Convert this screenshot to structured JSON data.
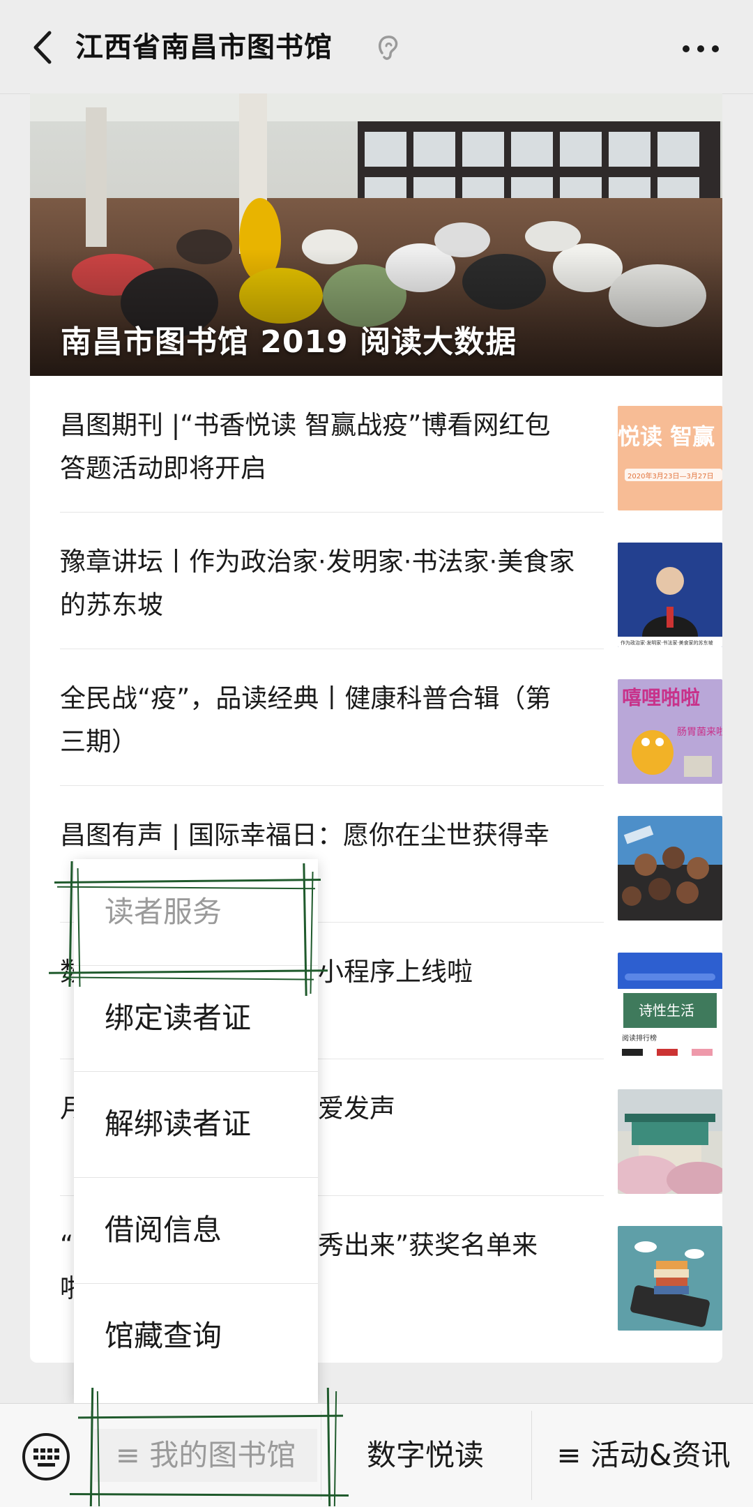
{
  "header": {
    "title": "江西省南昌市图书馆",
    "back_icon": "chevron-left-icon",
    "ear_icon": "ear-icon",
    "more_icon": "more-dots-icon"
  },
  "hero": {
    "title": "南昌市图书馆 2019 阅读大数据"
  },
  "articles": [
    {
      "title": "昌图期刊 |“书香悦读 智赢战疫”博看网红包答题活动即将开启",
      "thumb_text": "悦读 智赢",
      "thumb_sub": "2020年3月23日—3月27日"
    },
    {
      "title": "豫章讲坛丨作为政治家·发明家·书法家·美食家的苏东坡",
      "thumb_caption": "作为政治家·发明家·书法家·美食家的苏东坡"
    },
    {
      "title": "全民战“疫”，品读经典丨健康科普合辑（第三期）",
      "thumb_text": "嘻哩啪啦",
      "thumb_sub": "肠胃菌来啦"
    },
    {
      "title": "昌图有声 | 国际幸福日：愿你在尘世获得幸"
    },
    {
      "title": "数 小程序上线啦",
      "thumb_text": "诗性生活",
      "thumb_caption": "阅读排行榜"
    },
    {
      "title": "月 爱发声"
    },
    {
      "title": "“ 秀出来”获奖名单来啦"
    }
  ],
  "popup": {
    "header": "读者服务",
    "items": [
      "绑定读者证",
      "解绑读者证",
      "借阅信息",
      "馆藏查询"
    ]
  },
  "bottom_bar": {
    "keyboard_icon": "keyboard-icon",
    "tabs": [
      "≡ 我的图书馆",
      "数字悦读",
      "≡ 活动&资讯"
    ]
  }
}
